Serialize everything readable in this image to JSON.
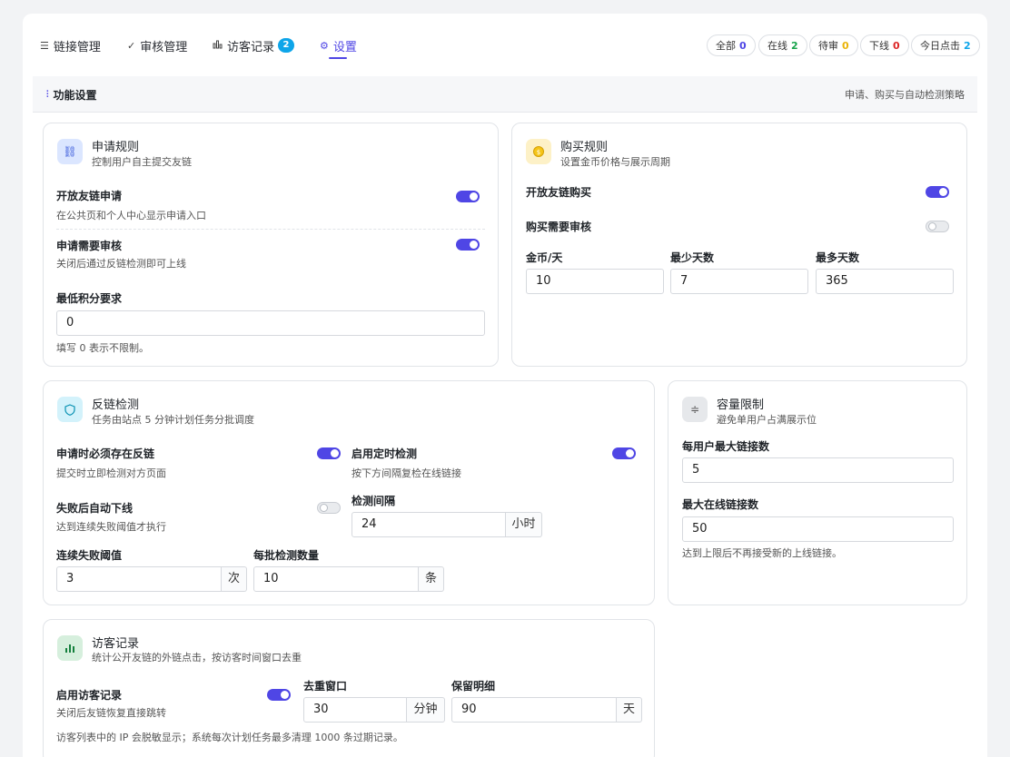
{
  "nav": {
    "tabs": [
      {
        "label": "链接管理",
        "icon": "list-icon"
      },
      {
        "label": "审核管理",
        "icon": "check-icon"
      },
      {
        "label": "访客记录",
        "icon": "bar-chart-icon",
        "badge": "2"
      },
      {
        "label": "设置",
        "icon": "gear-icon",
        "active": true
      }
    ],
    "stats": [
      {
        "label": "全部",
        "value": "0",
        "color": "#4f46e5"
      },
      {
        "label": "在线",
        "value": "2",
        "color": "#16a34a"
      },
      {
        "label": "待审",
        "value": "0",
        "color": "#eab308"
      },
      {
        "label": "下线",
        "value": "0",
        "color": "#dc2626"
      },
      {
        "label": "今日点击",
        "value": "2",
        "color": "#0ea5e9"
      }
    ]
  },
  "section": {
    "title": "功能设置",
    "desc": "申请、购买与自动检测策略"
  },
  "apply": {
    "title": "申请规则",
    "sub": "控制用户自主提交友链",
    "open_label": "开放友链申请",
    "open_hint": "在公共页和个人中心显示申请入口",
    "open_on": true,
    "review_label": "申请需要审核",
    "review_hint": "关闭后通过反链检测即可上线",
    "review_on": true,
    "min_points_label": "最低积分要求",
    "min_points_value": "0",
    "min_points_hint": "填写 0 表示不限制。"
  },
  "purchase": {
    "title": "购买规则",
    "sub": "设置金币价格与展示周期",
    "open_label": "开放友链购买",
    "open_on": true,
    "review_label": "购买需要审核",
    "review_on": false,
    "coins_label": "金币/天",
    "coins_value": "10",
    "min_days_label": "最少天数",
    "min_days_value": "7",
    "max_days_label": "最多天数",
    "max_days_value": "365"
  },
  "backlink": {
    "title": "反链检测",
    "sub": "任务由站点 5 分钟计划任务分批调度",
    "require_label": "申请时必须存在反链",
    "require_hint": "提交时立即检测对方页面",
    "require_on": true,
    "scheduled_label": "启用定时检测",
    "scheduled_hint": "按下方间隔复检在线链接",
    "scheduled_on": true,
    "auto_offline_label": "失败后自动下线",
    "auto_offline_hint": "达到连续失败阈值才执行",
    "auto_offline_on": false,
    "interval_label": "检测间隔",
    "interval_value": "24",
    "interval_unit": "小时",
    "threshold_label": "连续失败阈值",
    "threshold_value": "3",
    "threshold_unit": "次",
    "batch_label": "每批检测数量",
    "batch_value": "10",
    "batch_unit": "条"
  },
  "capacity": {
    "title": "容量限制",
    "sub": "避免单用户占满展示位",
    "per_user_label": "每用户最大链接数",
    "per_user_value": "5",
    "max_online_label": "最大在线链接数",
    "max_online_value": "50",
    "hint": "达到上限后不再接受新的上线链接。"
  },
  "visitor": {
    "title": "访客记录",
    "sub": "统计公开友链的外链点击，按访客时间窗口去重",
    "enable_label": "启用访客记录",
    "enable_hint": "关闭后友链恢复直接跳转",
    "enable_on": true,
    "window_label": "去重窗口",
    "window_value": "30",
    "window_unit": "分钟",
    "retain_label": "保留明细",
    "retain_value": "90",
    "retain_unit": "天",
    "footnote": "访客列表中的 IP 会脱敏显示；系统每次计划任务最多清理 1000 条过期记录。"
  }
}
